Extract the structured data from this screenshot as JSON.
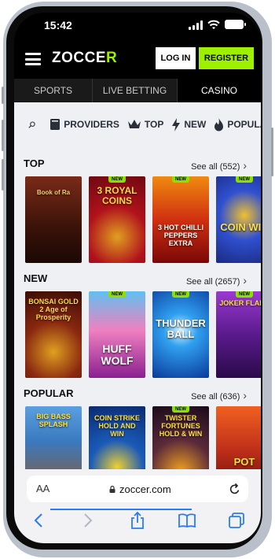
{
  "status_bar": {
    "time": "15:42"
  },
  "header": {
    "logo_main": "ZOCCE",
    "logo_accent": "R",
    "login_label": "LOG IN",
    "register_label": "REGISTER"
  },
  "tabs": [
    {
      "label": "SPORTS"
    },
    {
      "label": "LIVE BETTING"
    },
    {
      "label": "CASINO"
    }
  ],
  "categories": [
    {
      "label": "PROVIDERS",
      "icon": "book-icon"
    },
    {
      "label": "TOP",
      "icon": "crown-icon"
    },
    {
      "label": "NEW",
      "icon": "lightning-icon"
    },
    {
      "label": "POPULAR",
      "icon": "flame-icon"
    }
  ],
  "sections": {
    "top": {
      "title": "TOP",
      "see_all": "See all (552)",
      "games": [
        {
          "name": "Book of Ra",
          "badge": "",
          "bg": "#5a2015"
        },
        {
          "name": "3 ROYAL COINS",
          "badge": "NEW",
          "bg": "#b0121c"
        },
        {
          "name": "3 HOT CHILLI PEPPERS EXTRA",
          "badge": "NEW",
          "bg": "#c92b10"
        },
        {
          "name": "COIN WIN",
          "badge": "NEW",
          "bg": "#2a43b8"
        }
      ]
    },
    "new": {
      "title": "NEW",
      "see_all": "See all (2657)",
      "games": [
        {
          "name": "BONSAI GOLD 2 Age of Prosperity",
          "badge": "",
          "bg": "#6a1c0c"
        },
        {
          "name": "HUFF WOLF",
          "badge": "NEW",
          "bg": "#c93fa8"
        },
        {
          "name": "THUNDER BALL",
          "badge": "NEW",
          "bg": "#0e58b5"
        },
        {
          "name": "JOKER FLARE",
          "badge": "NEW",
          "bg": "#5a1a8c"
        }
      ]
    },
    "popular": {
      "title": "POPULAR",
      "see_all": "See all (636)",
      "games": [
        {
          "name": "BIG BASS SPLASH",
          "badge": "",
          "bg": "#3a7abf"
        },
        {
          "name": "COIN STRIKE HOLD AND WIN",
          "badge": "",
          "bg": "#114aa8"
        },
        {
          "name": "TWISTER FORTUNES HOLD & WIN",
          "badge": "NEW",
          "bg": "#2a1a2a"
        },
        {
          "name": "POT",
          "badge": "",
          "bg": "#c0301a"
        }
      ]
    }
  },
  "browser": {
    "aa_label": "AA",
    "url": "zoccer.com"
  },
  "colors": {
    "brand": "#9df000",
    "accent": "#2a7bf6"
  }
}
